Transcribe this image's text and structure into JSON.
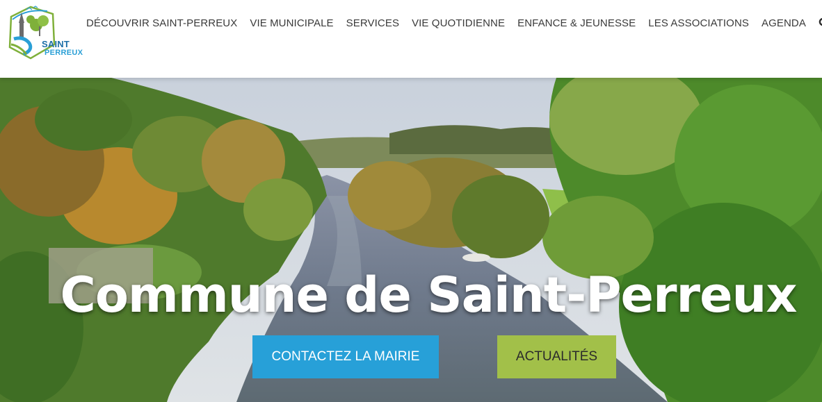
{
  "logo": {
    "line1": "SAINT",
    "line2": "PERREUX",
    "colors": {
      "blue": "#1d6fa8",
      "light_blue": "#2a9fd6",
      "green": "#7fb03a"
    }
  },
  "nav": {
    "items": [
      "DÉCOUVRIR SAINT-PERREUX",
      "VIE MUNICIPALE",
      "SERVICES",
      "VIE QUOTIDIENNE",
      "ENFANCE & JEUNESSE",
      "LES ASSOCIATIONS",
      "AGENDA"
    ],
    "search_icon": "search-icon"
  },
  "hero": {
    "title": "Commune de Saint-Perreux",
    "buttons": {
      "contact": "CONTACTEZ LA MAIRIE",
      "news": "ACTUALITÉS"
    },
    "colors": {
      "contact_bg": "#27a0d8",
      "news_bg": "#a2c049"
    }
  }
}
